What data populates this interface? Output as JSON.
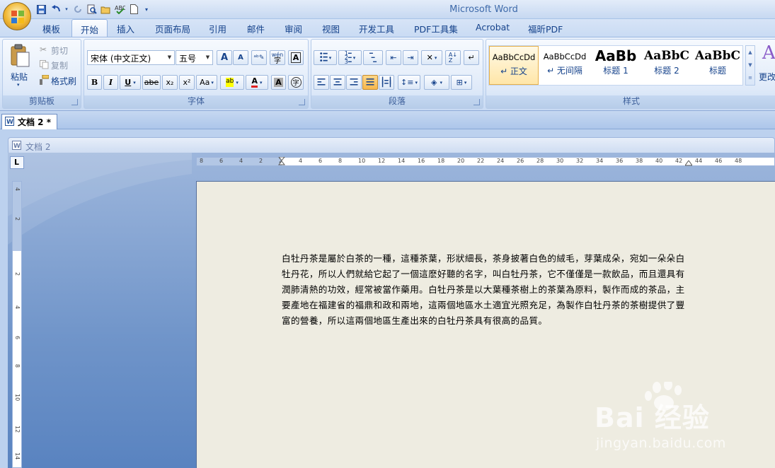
{
  "app_title": "Microsoft Word",
  "qat": {
    "save": "save-icon",
    "undo": "undo-icon",
    "redo": "redo-icon",
    "preview": "print-preview-icon",
    "open": "open-icon",
    "spell": "spellcheck-icon",
    "new": "new-doc-icon",
    "more": "customize-icon"
  },
  "tabs": [
    "模板",
    "开始",
    "插入",
    "页面布局",
    "引用",
    "邮件",
    "审阅",
    "视图",
    "开发工具",
    "PDF工具集",
    "Acrobat",
    "福昕PDF"
  ],
  "active_tab": "开始",
  "clipboard": {
    "title": "剪贴板",
    "paste": "粘贴",
    "cut": "剪切",
    "copy": "复制",
    "format_painter": "格式刷"
  },
  "font": {
    "title": "字体",
    "font_name": "宋体 (中文正文)",
    "font_size": "五号",
    "bold": "B",
    "italic": "I",
    "underline": "U",
    "strike": "abe",
    "subscript": "x₂",
    "superscript": "x²",
    "case": "Aa",
    "grow": "A",
    "shrink": "A",
    "wen": "wén",
    "highlight": "ab",
    "color": "A",
    "char_shade": "A",
    "enclose": "字"
  },
  "paragraph": {
    "title": "段落"
  },
  "styles": {
    "title": "样式",
    "items": [
      {
        "sample": "AaBbCcDd",
        "name": "↵ 正文"
      },
      {
        "sample": "AaBbCcDd",
        "name": "↵ 无间隔"
      },
      {
        "sample": "AaBb",
        "name": "标题 1"
      },
      {
        "sample": "AaBbC",
        "name": "标题 2"
      },
      {
        "sample": "AaBbC",
        "name": "标题"
      }
    ],
    "change": "更改"
  },
  "doc_tab": "文档 2 *",
  "mdi_title": "文档 2",
  "hruler_ticks": [
    "8",
    "6",
    "4",
    "2",
    "2",
    "4",
    "6",
    "8",
    "10",
    "12",
    "14",
    "16",
    "18",
    "20",
    "22",
    "24",
    "26",
    "28",
    "30",
    "32",
    "34",
    "36",
    "38",
    "40",
    "42",
    "44",
    "46",
    "48"
  ],
  "vruler_ticks": [
    "4",
    "2",
    "2",
    "4",
    "6",
    "8",
    "10",
    "12",
    "14"
  ],
  "body_text": "白牡丹茶是屬於白茶的一種，這種茶葉，形狀細長，茶身披著白色的絨毛，芽葉成朵，宛如一朵朵白牡丹花，所以人們就給它起了一個這麽好聽的名字，叫白牡丹茶，它不僅僅是一款飲品，而且還具有潤肺清熱的功效，經常被當作藥用。白牡丹茶是以大葉種茶樹上的茶葉為原料，製作而成的茶品，主要產地在福建省的福鼎和政和兩地，這兩個地區水土適宜光照充足，為製作白牡丹茶的茶樹提供了豐富的營養，所以這兩個地區生產出來的白牡丹茶具有很高的品質。",
  "watermark": {
    "brand": "Bai  经验",
    "url": "jingyan.baidu.com"
  }
}
